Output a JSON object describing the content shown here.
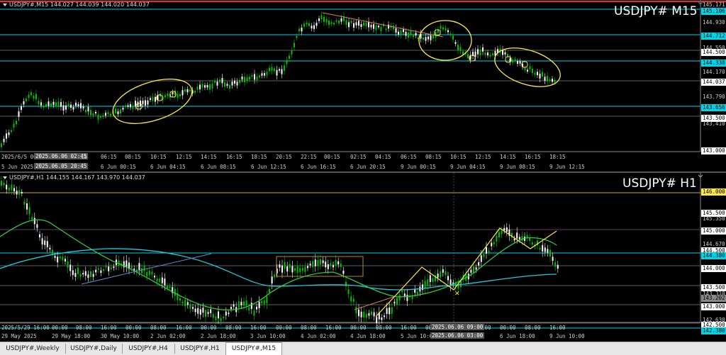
{
  "m15": {
    "header": "USDJPY#,M15  144.027 144.039 144.020 144.037",
    "title": "USDJPY# M15",
    "price_tags": [
      {
        "text": "145.171",
        "kind": "plain"
      },
      {
        "text": "145.106",
        "kind": "cyan"
      },
      {
        "text": "144.930",
        "kind": "plain"
      },
      {
        "text": "144.712",
        "kind": "cyan"
      },
      {
        "text": "144.550",
        "kind": "plain"
      },
      {
        "text": "144.500",
        "kind": "white"
      },
      {
        "text": "144.338",
        "kind": "cyan"
      },
      {
        "text": "144.170",
        "kind": "plain"
      },
      {
        "text": "144.037",
        "kind": "white"
      },
      {
        "text": "143.790",
        "kind": "plain"
      },
      {
        "text": "143.656",
        "kind": "cyan"
      },
      {
        "text": "143.500",
        "kind": "white"
      },
      {
        "text": "143.410",
        "kind": "plain"
      },
      {
        "text": "143.000",
        "kind": "white"
      }
    ],
    "time_row1": [
      "2025/6/5 00:",
      "06:15",
      "08:15",
      "10:15",
      "12:15",
      "14:15",
      "16:15",
      "18:15",
      "20:15",
      "22:15",
      "00:15",
      "02:15",
      "04:15",
      "06:15",
      "08:15",
      "10:15",
      "12:15",
      "14:15",
      "16:15",
      "18:15"
    ],
    "time_row1_box": "2025.06.06 02:45",
    "time_row1_tail": "15",
    "time_row2": [
      "5 Jun 2025",
      "6 Jun 00:15",
      "6 Jun 04:15",
      "6 Jun 08:15",
      "6 Jun 12:15",
      "6 Jun 16:15",
      "6 Jun 20:15",
      "9 Jun 00:15",
      "9 Jun 04:15",
      "9 Jun 08:15",
      "9 Jun 12:15"
    ],
    "time_row2_box": "2025.06.05 20:45"
  },
  "h1": {
    "header": "USDJPY#,H1  144.155 144.167 143.970 144.037",
    "title": "USDJPY# H1",
    "price_tags": [
      {
        "text": "146.000",
        "kind": "yellow"
      },
      {
        "text": "145.500",
        "kind": "white"
      },
      {
        "text": "145.350",
        "kind": "plain"
      },
      {
        "text": "145.000",
        "kind": "white"
      },
      {
        "text": "144.670",
        "kind": "plain"
      },
      {
        "text": "144.500",
        "kind": "white"
      },
      {
        "text": "144.380",
        "kind": "cyan"
      },
      {
        "text": "144.000",
        "kind": "white"
      },
      {
        "text": "143.500",
        "kind": "white"
      },
      {
        "text": "143.310",
        "kind": "plain"
      },
      {
        "text": "143.202",
        "kind": "gray"
      },
      {
        "text": "143.000",
        "kind": "white"
      },
      {
        "text": "142.630",
        "kind": "plain"
      },
      {
        "text": "142.500",
        "kind": "white"
      },
      {
        "text": "142.380",
        "kind": "cyan"
      }
    ],
    "time_row1": [
      "2025/5/29 16:00",
      "00:00",
      "08:00",
      "16:00",
      "00:00",
      "08:00",
      "16:00",
      "00:00",
      "08:00",
      "16:00",
      "00:00",
      "08:00",
      "16:00",
      "00:00",
      "08:00",
      "16:00",
      "00:00",
      "08:00",
      "16:00",
      "00:00",
      "08:00",
      "16:00"
    ],
    "time_row1_box": "2025.06.06 09:00",
    "time_row2": [
      "29 May 2025",
      "29 May 18:00",
      "30 May 10:00",
      "2 Jun 02:00",
      "2 Jun 18:00",
      "3 Jun 10:00",
      "4 Jun 02:00",
      "4 Jun 18:00",
      "5 Jun 10:00",
      "6 Jun 18:00",
      "9 Jun 10:00"
    ],
    "time_row2_box": "2025.06.06 03:00"
  },
  "tabs": [
    "USDJPY#,Weekly",
    "USDJPY#,Daily",
    "USDJPY#,H4",
    "USDJPY#,H1",
    "USDJPY#,M15"
  ],
  "active_tab": "USDJPY#,M15",
  "colors": {
    "bull": "#ffffff",
    "bear": "#00c000",
    "cyan": "#00d5e8",
    "yellow": "#ffe94d",
    "ma_green": "#2ecc40",
    "ma_cyan": "#26c6da",
    "trend": "#e07a5f"
  }
}
